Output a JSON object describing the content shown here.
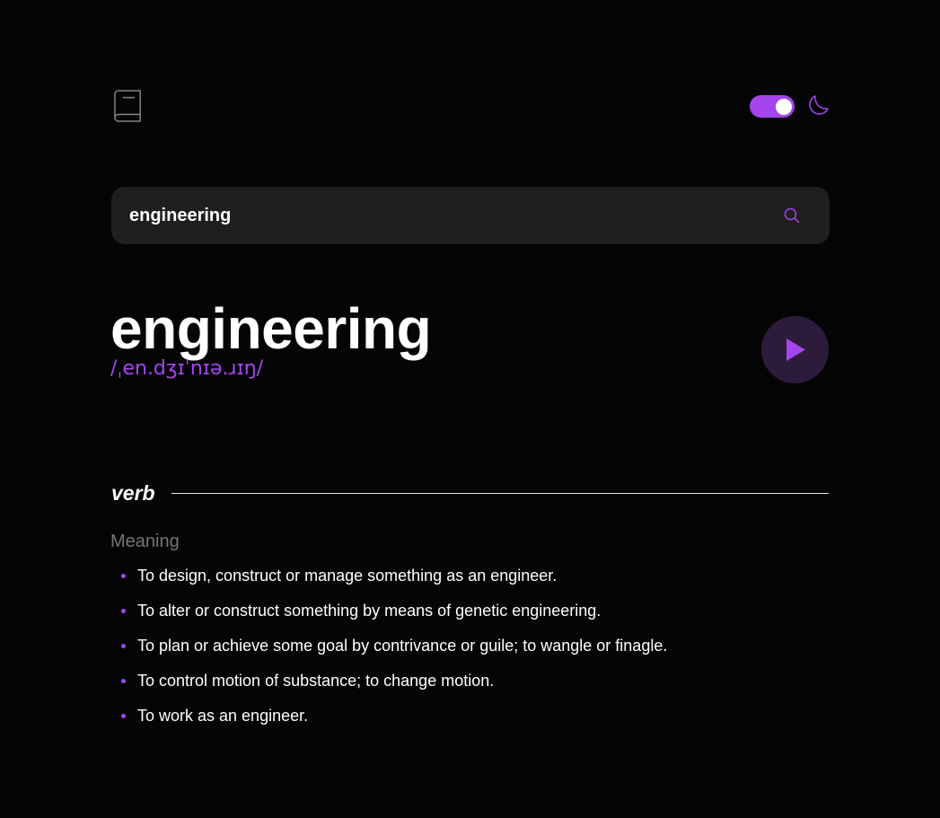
{
  "header": {
    "logo_icon": "book-icon",
    "theme_toggle_state": "on",
    "theme_icon": "moon-icon"
  },
  "search": {
    "value": "engineering",
    "icon": "search-icon"
  },
  "entry": {
    "word": "engineering",
    "phonetic": "/ˌen.dʒɪˈnɪə.ɹɪŋ/",
    "play_icon": "play-icon"
  },
  "meanings": [
    {
      "part_of_speech": "verb",
      "label": "Meaning",
      "definitions": [
        "To design, construct or manage something as an engineer.",
        "To alter or construct something by means of genetic engineering.",
        "To plan or achieve some goal by contrivance or guile; to wangle or finagle.",
        "To control motion of substance; to change motion.",
        "To work as an engineer."
      ]
    }
  ],
  "colors": {
    "background": "#050505",
    "accent": "#a445ed",
    "search_bg": "#1f1f1f",
    "muted_text": "#757575"
  }
}
